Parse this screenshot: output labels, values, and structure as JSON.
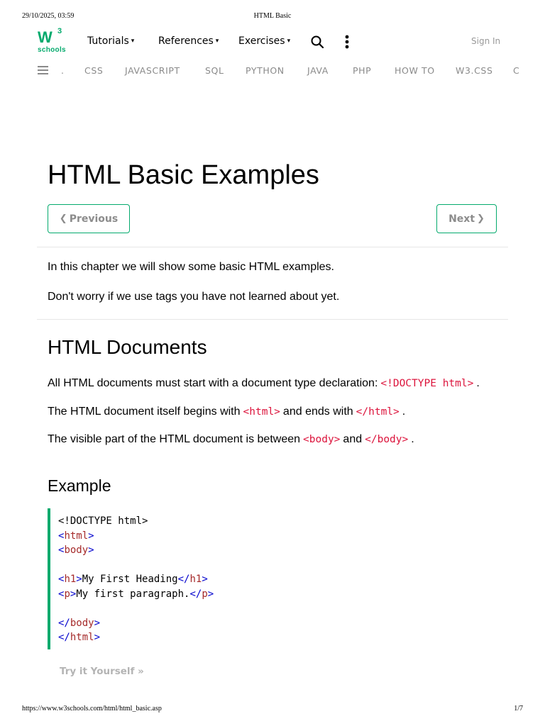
{
  "print": {
    "datetime": "29/10/2025, 03:59",
    "title": "HTML Basic",
    "url": "https://www.w3schools.com/html/html_basic.asp",
    "page": "1/7"
  },
  "logo": {
    "main": "W",
    "sup": "3",
    "text": "schools"
  },
  "nav": {
    "tutorials": "Tutorials",
    "references": "References",
    "exercises": "Exercises",
    "caret": "▾",
    "sign_in": "Sign In"
  },
  "subnav": [
    ".",
    "CSS",
    "JAVASCRIPT",
    "SQL",
    "PYTHON",
    "JAVA",
    "PHP",
    "HOW TO",
    "W3.CSS",
    "C"
  ],
  "page": {
    "title": "HTML Basic Examples",
    "prev_label": "Previous",
    "next_label": "Next",
    "prev_chevron": "❮",
    "next_chevron": "❯",
    "intro1": "In this chapter we will show some basic HTML examples.",
    "intro2": "Don't worry if we use tags you have not learned about yet.",
    "section_title": "HTML Documents",
    "p_doctype_before": "All HTML documents must start with a document type declaration:",
    "p_doctype_code": "<!DOCTYPE html>",
    "p_doctype_after": ".",
    "p_html_before": "The HTML document itself begins with",
    "p_html_code1": "<html>",
    "p_html_mid": "and ends with",
    "p_html_code2": "</html>",
    "p_html_after": ".",
    "p_body_before": "The visible part of the HTML document is between",
    "p_body_code1": "<body>",
    "p_body_mid": "and",
    "p_body_code2": "</body>",
    "p_body_after": ".",
    "example_title": "Example",
    "try_it": "Try it Yourself »"
  },
  "code": {
    "doctype": "<!DOCTYPE html>",
    "lt": "<",
    "gt": ">",
    "lt_slash": "</",
    "html": "html",
    "body": "body",
    "h1": "h1",
    "p": "p",
    "h1_text": "My First Heading",
    "p_text": "My first paragraph."
  },
  "colors": {
    "brand_green": "#04AA6D",
    "code_red": "#dc143c",
    "tag_bracket": "#0000cd",
    "tag_name": "#a52a2a"
  }
}
